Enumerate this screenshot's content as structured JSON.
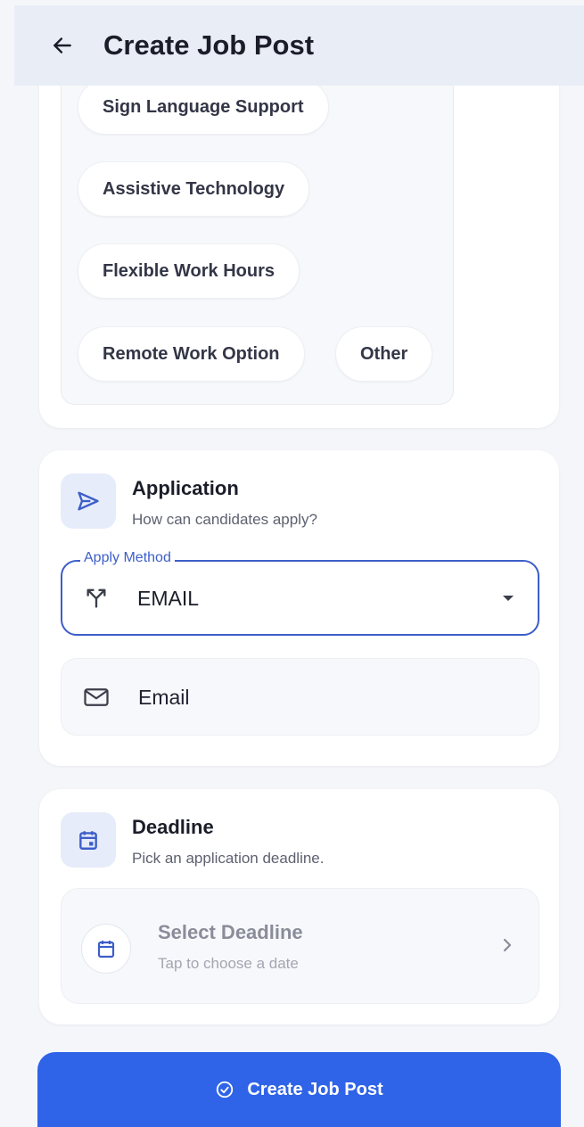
{
  "header": {
    "title": "Create Job Post"
  },
  "accommodations": {
    "chips": [
      "Sign Language Support",
      "Assistive Technology",
      "Flexible Work Hours",
      "Remote Work Option",
      "Other"
    ]
  },
  "application": {
    "title": "Application",
    "subtitle": "How can candidates apply?",
    "apply_method_label": "Apply Method",
    "apply_method_value": "EMAIL",
    "email_placeholder": "Email"
  },
  "deadline": {
    "title": "Deadline",
    "subtitle": "Pick an application deadline.",
    "select_title": "Select Deadline",
    "select_subtitle": "Tap to choose a date"
  },
  "submit": {
    "label": "Create Job Post"
  },
  "colors": {
    "primary": "#2f63e8",
    "accent_outline": "#3d5ec9",
    "icon_bg": "#e6ecfa",
    "appbar_bg": "#e9edf6"
  },
  "icons": [
    "back-arrow-icon",
    "send-icon",
    "fork-icon",
    "dropdown-icon",
    "mail-icon",
    "calendar-icon",
    "chevron-right-icon",
    "check-circle-icon"
  ]
}
